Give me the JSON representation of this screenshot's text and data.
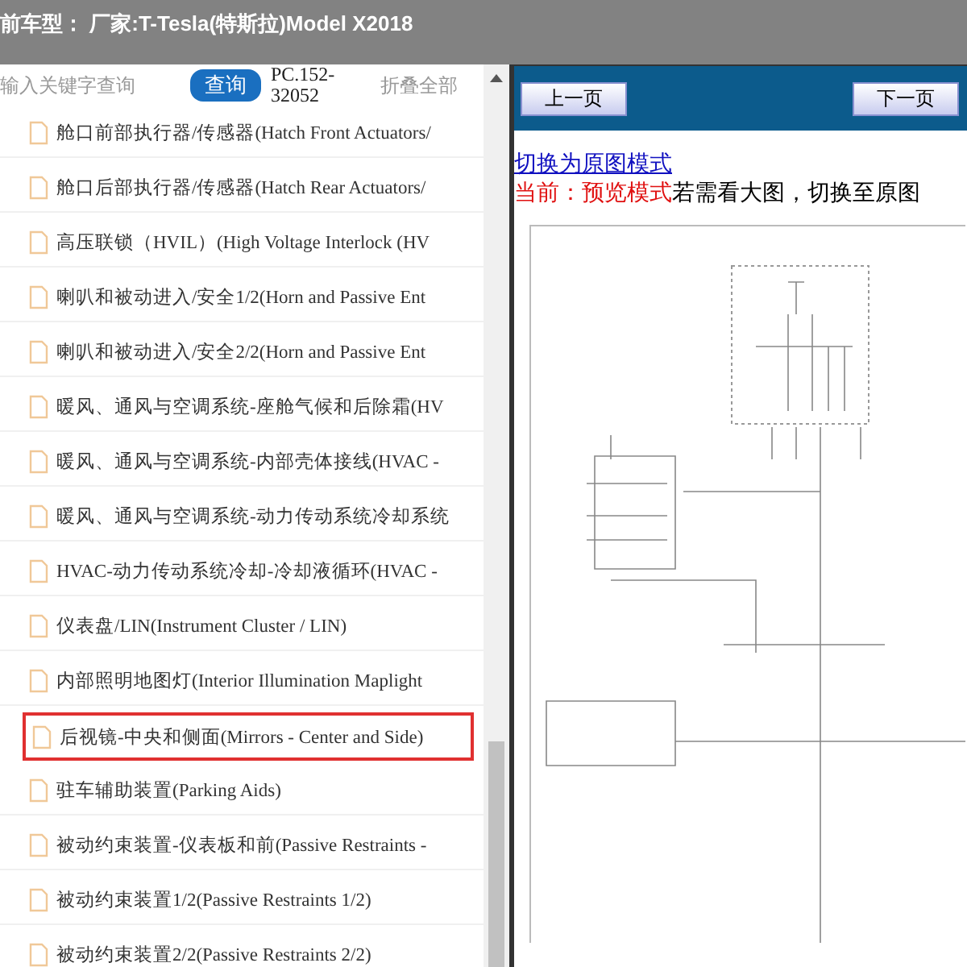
{
  "header": {
    "title": "前车型： 厂家:T-Tesla(特斯拉)Model X2018"
  },
  "search": {
    "placeholder": "输入关键字查询",
    "button": "查询",
    "code": "PC.152-32052",
    "collapse": "折叠全部"
  },
  "items": [
    {
      "label": "舱口前部执行器/传感器(Hatch Front Actuators/",
      "selected": false
    },
    {
      "label": "舱口后部执行器/传感器(Hatch Rear Actuators/",
      "selected": false
    },
    {
      "label": "高压联锁（HVIL）(High Voltage Interlock (HV",
      "selected": false
    },
    {
      "label": "喇叭和被动进入/安全1/2(Horn and Passive Ent",
      "selected": false
    },
    {
      "label": "喇叭和被动进入/安全2/2(Horn and Passive Ent",
      "selected": false
    },
    {
      "label": "暖风、通风与空调系统-座舱气候和后除霜(HV",
      "selected": false
    },
    {
      "label": "暖风、通风与空调系统-内部壳体接线(HVAC -",
      "selected": false
    },
    {
      "label": "暖风、通风与空调系统-动力传动系统冷却系统",
      "selected": false
    },
    {
      "label": "HVAC-动力传动系统冷却-冷却液循环(HVAC -",
      "selected": false
    },
    {
      "label": "仪表盘/LIN(Instrument Cluster / LIN)",
      "selected": false
    },
    {
      "label": "内部照明地图灯(Interior Illumination Maplight",
      "selected": false
    },
    {
      "label": "后视镜-中央和侧面(Mirrors - Center and Side)",
      "selected": true
    },
    {
      "label": "驻车辅助装置(Parking Aids)",
      "selected": false
    },
    {
      "label": "被动约束装置-仪表板和前(Passive Restraints -",
      "selected": false
    },
    {
      "label": "被动约束装置1/2(Passive Restraints 1/2)",
      "selected": false
    },
    {
      "label": "被动约束装置2/2(Passive Restraints 2/2)",
      "selected": false
    }
  ],
  "viewer": {
    "prev": "上一页",
    "next": "下一页",
    "switch_link": "切换为原图模式",
    "mode_label": "当前：预览模式",
    "mode_hint": "若需看大图，切换至原图"
  }
}
